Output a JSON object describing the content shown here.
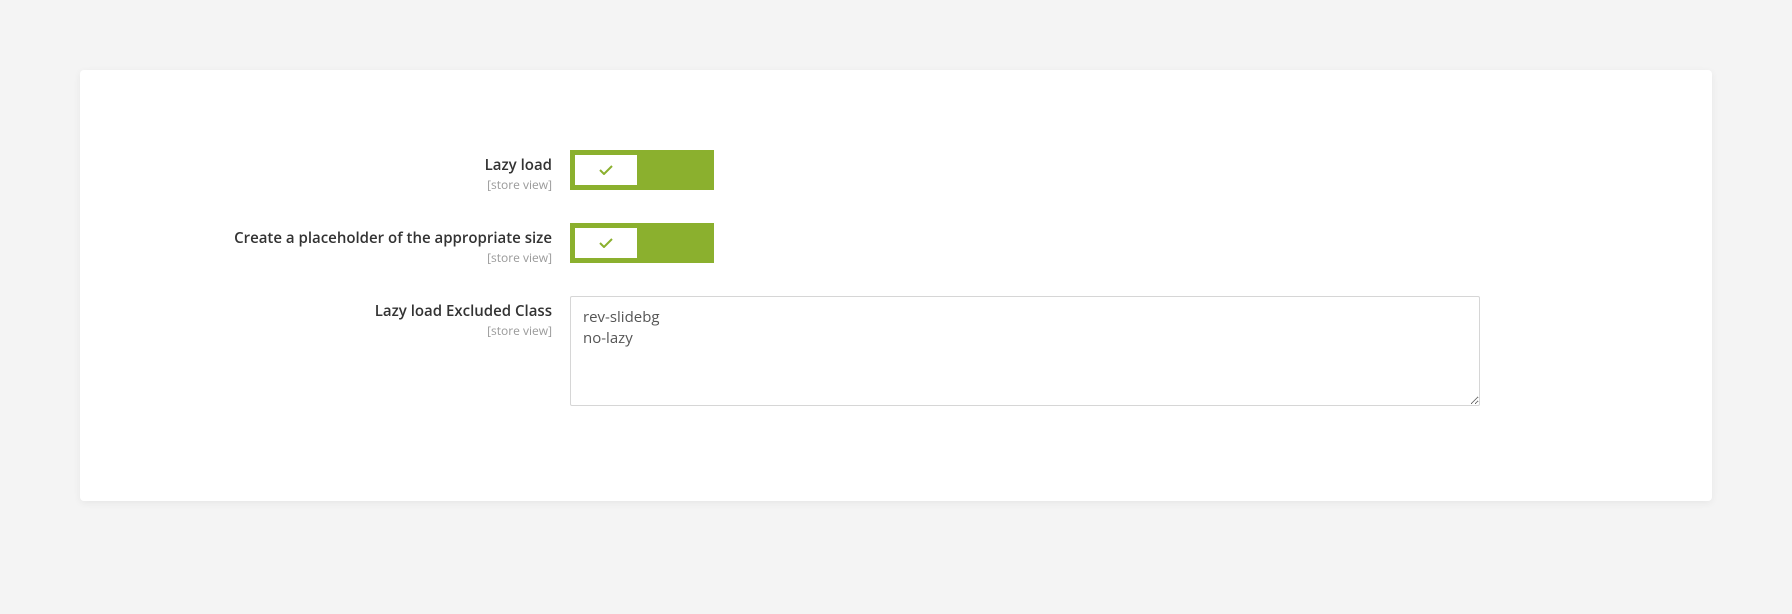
{
  "fields": {
    "lazy_load": {
      "label": "Lazy load",
      "scope": "[store view]",
      "enabled": true
    },
    "placeholder_size": {
      "label": "Create a placeholder of the appropriate size",
      "scope": "[store view]",
      "enabled": true
    },
    "excluded_class": {
      "label": "Lazy load Excluded Class",
      "scope": "[store view]",
      "value": "rev-slidebg\nno-lazy"
    }
  }
}
